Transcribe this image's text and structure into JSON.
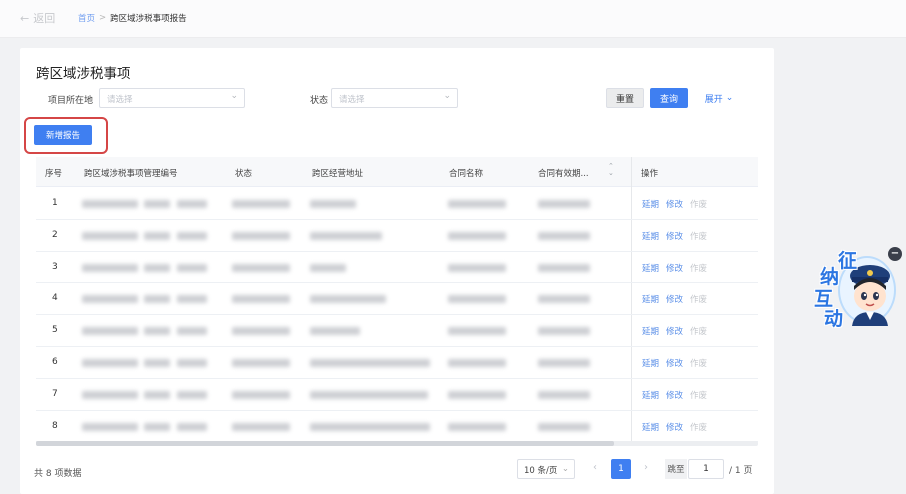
{
  "topbar": {
    "back_label": "返回",
    "breadcrumb": {
      "home": "首页",
      "separator": ">",
      "current": "跨区域涉税事项报告"
    }
  },
  "page": {
    "title": "跨区域涉税事项"
  },
  "filters": {
    "project_location": {
      "label": "项目所在地",
      "placeholder": "请选择"
    },
    "status": {
      "label": "状态",
      "placeholder": "请选择"
    },
    "reset_label": "重置",
    "query_label": "查询",
    "expand_label": "展开"
  },
  "toolbar": {
    "add_label": "新增报告"
  },
  "table": {
    "columns": [
      "序号",
      "跨区域涉税事项管理编号",
      "状态",
      "跨区经营地址",
      "合同名称",
      "合同有效期...",
      "操作"
    ],
    "rows": [
      {
        "index": "1"
      },
      {
        "index": "2"
      },
      {
        "index": "3"
      },
      {
        "index": "4"
      },
      {
        "index": "5"
      },
      {
        "index": "6"
      },
      {
        "index": "7"
      },
      {
        "index": "8"
      }
    ],
    "actions": {
      "extend": "延期",
      "modify": "修改",
      "void": "作废"
    }
  },
  "pagination": {
    "total_text": "共 8 项数据",
    "page_size": "10 条/页",
    "current_page": "1",
    "goto_label": "跳至",
    "goto_value": "1",
    "total_pages": "/ 1 页"
  },
  "widget": {
    "chars": [
      "征",
      "纳",
      "互",
      "动"
    ]
  },
  "colors": {
    "primary": "#3f7ff1",
    "highlight": "#d54646",
    "link": "#5b8fe8"
  }
}
